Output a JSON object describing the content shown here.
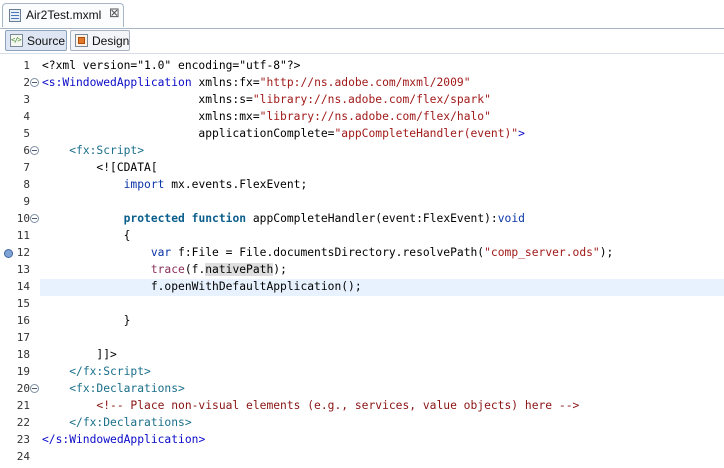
{
  "tab": {
    "title": "Air2Test.mxml",
    "close_glyph": "⊠",
    "icon": "mxml-file-icon"
  },
  "toolbar": {
    "source_label": "Source",
    "design_label": "Design"
  },
  "editor": {
    "current_line": 14,
    "lines": [
      {
        "n": "1",
        "fold": false,
        "bp": false,
        "text": "<?xml version=\"1.0\" encoding=\"utf-8\"?>"
      },
      {
        "n": "2",
        "fold": true,
        "bp": false,
        "text": "<s:WindowedApplication xmlns:fx=\"http://ns.adobe.com/mxml/2009\""
      },
      {
        "n": "3",
        "fold": false,
        "bp": false,
        "text": "                       xmlns:s=\"library://ns.adobe.com/flex/spark\""
      },
      {
        "n": "4",
        "fold": false,
        "bp": false,
        "text": "                       xmlns:mx=\"library://ns.adobe.com/flex/halo\""
      },
      {
        "n": "5",
        "fold": false,
        "bp": false,
        "text": "                       applicationComplete=\"appCompleteHandler(event)\">"
      },
      {
        "n": "6",
        "fold": true,
        "bp": false,
        "text": "    <fx:Script>"
      },
      {
        "n": "7",
        "fold": false,
        "bp": false,
        "text": "        <![CDATA["
      },
      {
        "n": "8",
        "fold": false,
        "bp": false,
        "text": "            import mx.events.FlexEvent;"
      },
      {
        "n": "9",
        "fold": false,
        "bp": false,
        "text": ""
      },
      {
        "n": "10",
        "fold": true,
        "bp": false,
        "text": "            protected function appCompleteHandler(event:FlexEvent):void"
      },
      {
        "n": "11",
        "fold": false,
        "bp": false,
        "text": "            {"
      },
      {
        "n": "12",
        "fold": false,
        "bp": true,
        "text": "                var f:File = File.documentsDirectory.resolvePath(\"comp_server.ods\");"
      },
      {
        "n": "13",
        "fold": false,
        "bp": false,
        "text": "                trace(f.nativePath);"
      },
      {
        "n": "14",
        "fold": false,
        "bp": false,
        "text": "                f.openWithDefaultApplication();"
      },
      {
        "n": "15",
        "fold": false,
        "bp": false,
        "text": ""
      },
      {
        "n": "16",
        "fold": false,
        "bp": false,
        "text": "            }"
      },
      {
        "n": "17",
        "fold": false,
        "bp": false,
        "text": ""
      },
      {
        "n": "18",
        "fold": false,
        "bp": false,
        "text": "        ]]>"
      },
      {
        "n": "19",
        "fold": false,
        "bp": false,
        "text": "    </fx:Script>"
      },
      {
        "n": "20",
        "fold": true,
        "bp": false,
        "text": "    <fx:Declarations>"
      },
      {
        "n": "21",
        "fold": false,
        "bp": false,
        "text": "        <!-- Place non-visual elements (e.g., services, value objects) here -->"
      },
      {
        "n": "22",
        "fold": false,
        "bp": false,
        "text": "    </fx:Declarations>"
      },
      {
        "n": "23",
        "fold": false,
        "bp": false,
        "text": "</s:WindowedApplication>"
      },
      {
        "n": "24",
        "fold": false,
        "bp": false,
        "text": ""
      }
    ]
  }
}
